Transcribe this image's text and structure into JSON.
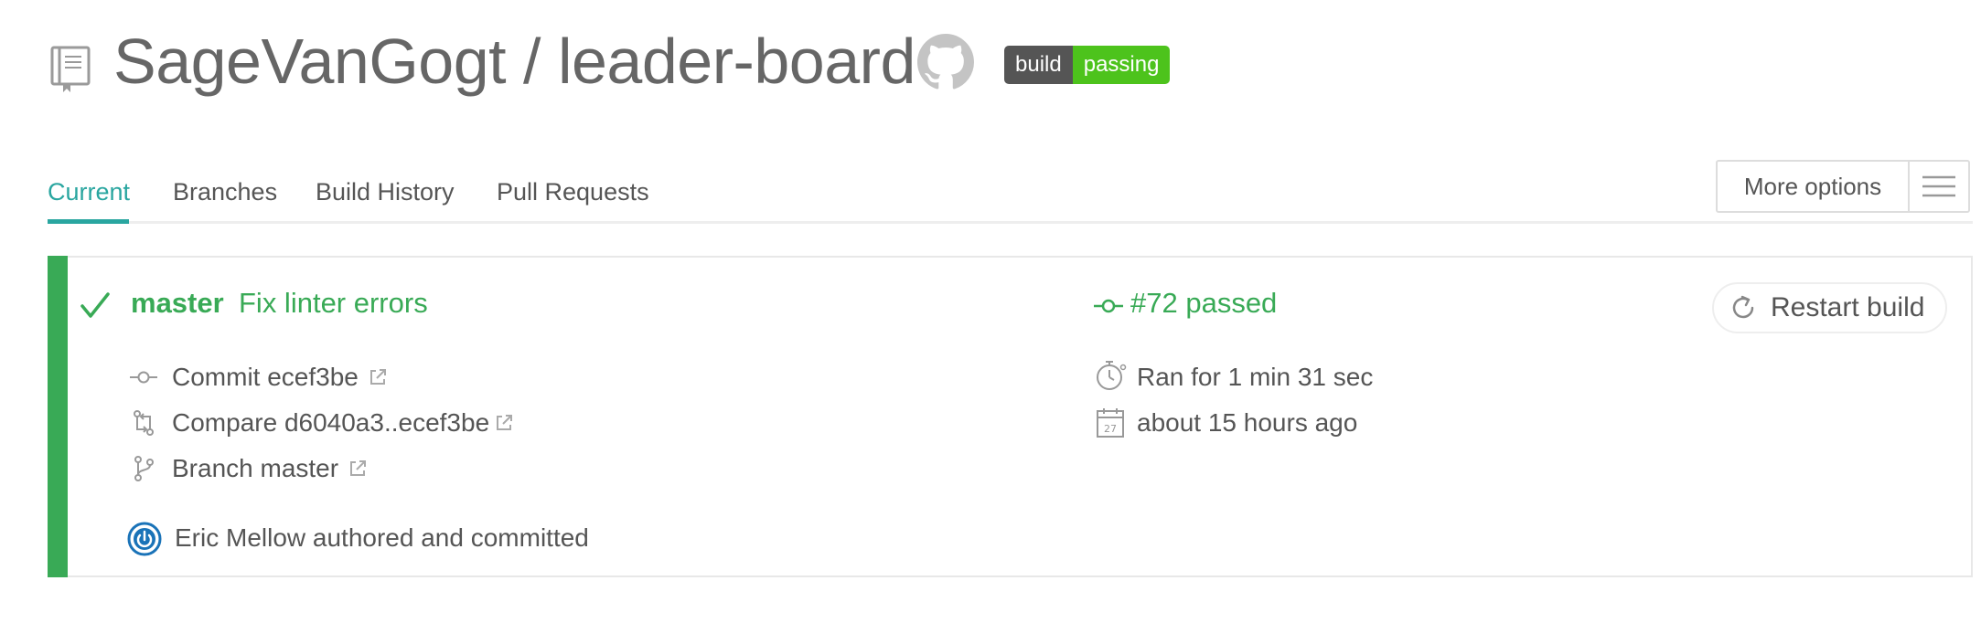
{
  "header": {
    "repo_title": "SageVanGogt / leader-board",
    "badge_left": "build",
    "badge_right": "passing"
  },
  "tabs": [
    {
      "label": "Current"
    },
    {
      "label": "Branches"
    },
    {
      "label": "Build History"
    },
    {
      "label": "Pull Requests"
    }
  ],
  "more_options": {
    "label": "More options"
  },
  "build": {
    "branch": "master",
    "message": "Fix linter errors",
    "number_status": "#72 passed",
    "restart_label": "Restart build",
    "commit": "Commit ecef3be",
    "compare": "Compare d6040a3..ecef3be",
    "branch_link": "Branch master",
    "duration": "Ran for 1 min 31 sec",
    "finished": "about 15 hours ago",
    "calendar_day": "27",
    "author": "Eric Mellow authored and committed"
  },
  "colors": {
    "accent": "#2aa6a0",
    "passed": "#39aa56",
    "badge_passing": "#4dc31c",
    "badge_dark": "#555555",
    "text": "#666666"
  }
}
